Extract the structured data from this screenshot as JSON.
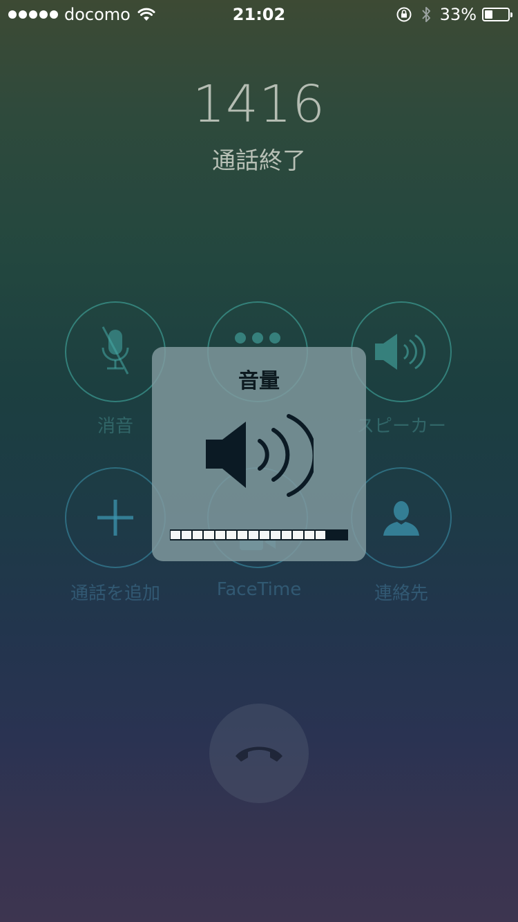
{
  "status_bar": {
    "carrier": "docomo",
    "time": "21:02",
    "battery_text": "33%",
    "battery_level": 0.33,
    "signal_bars": 5
  },
  "caller": {
    "number": "1416",
    "status": "通話終了"
  },
  "buttons": {
    "mute": {
      "label": "消音",
      "icon": "mic-off-icon"
    },
    "keypad": {
      "label": "",
      "icon": "dots-icon"
    },
    "speaker": {
      "label": "スピーカー",
      "icon": "speaker-icon"
    },
    "add_call": {
      "label": "通話を追加",
      "icon": "plus-icon"
    },
    "facetime": {
      "label": "FaceTime",
      "icon": "facetime-icon"
    },
    "contacts": {
      "label": "連絡先",
      "icon": "person-icon"
    }
  },
  "end_call": {
    "icon": "phone-hangup-icon"
  },
  "volume_hud": {
    "title": "音量",
    "level": 14,
    "max": 16
  },
  "colors": {
    "accent": "#46b4aa",
    "hud_background": "#829ba0",
    "hud_text": "#0d1a20"
  }
}
